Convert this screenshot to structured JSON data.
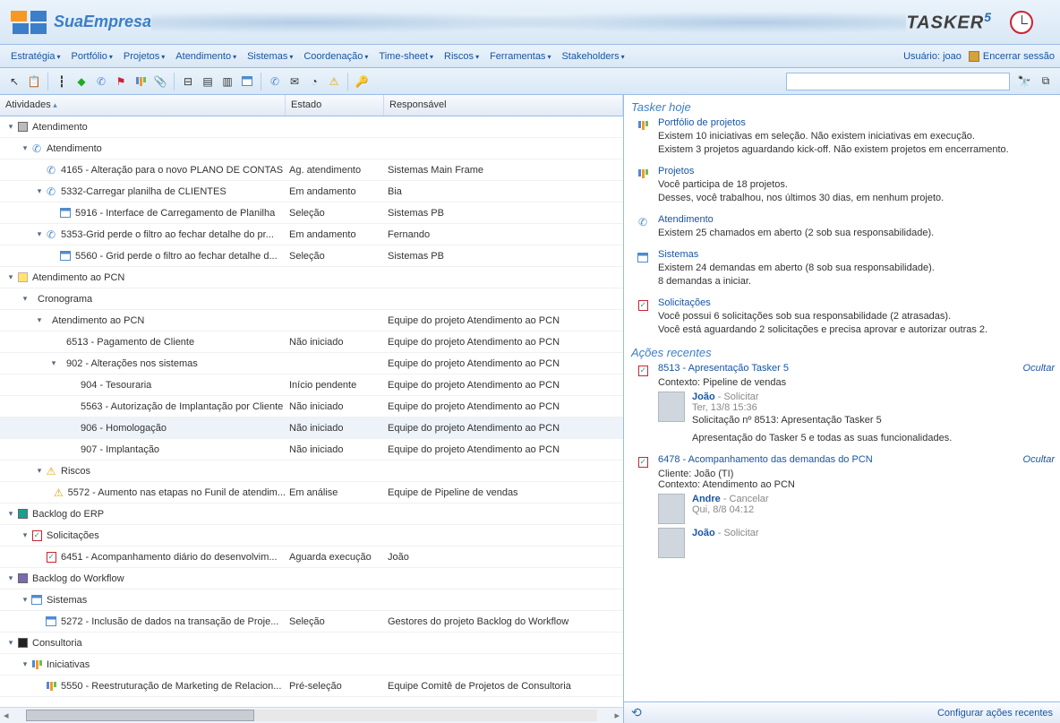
{
  "header": {
    "company": "SuaEmpresa",
    "brand": "TASKER",
    "brand_version": "5"
  },
  "menu": [
    "Estratégia",
    "Portfólio",
    "Projetos",
    "Atendimento",
    "Sistemas",
    "Coordenação",
    "Time-sheet",
    "Riscos",
    "Ferramentas",
    "Stakeholders"
  ],
  "user": {
    "label": "Usuário: joao",
    "logout": "Encerrar sessão"
  },
  "search_placeholder": "",
  "grid": {
    "columns": {
      "activities": "Atividades",
      "state": "Estado",
      "responsible": "Responsável"
    },
    "rows": [
      {
        "depth": 0,
        "exp": "▾",
        "icon": "sq-grey",
        "label": "Atendimento"
      },
      {
        "depth": 1,
        "exp": "▾",
        "icon": "phone",
        "label": "Atendimento"
      },
      {
        "depth": 2,
        "exp": "",
        "icon": "phone",
        "label": "4165 - Alteração para o novo PLANO DE CONTAS",
        "state": "Ag. atendimento",
        "resp": "Sistemas Main Frame"
      },
      {
        "depth": 2,
        "exp": "▾",
        "icon": "phone",
        "label": "5332-Carregar planilha de CLIENTES",
        "state": "Em andamento",
        "resp": "Bia"
      },
      {
        "depth": 3,
        "exp": "",
        "icon": "cal",
        "label": "5916 - Interface de Carregamento de Planilha",
        "state": "Seleção",
        "resp": "Sistemas PB"
      },
      {
        "depth": 2,
        "exp": "▾",
        "icon": "phone",
        "label": "5353-Grid perde o filtro ao fechar detalhe do pr...",
        "state": "Em andamento",
        "resp": "Fernando"
      },
      {
        "depth": 3,
        "exp": "",
        "icon": "cal",
        "label": "5560 - Grid perde o filtro ao fechar detalhe d...",
        "state": "Seleção",
        "resp": "Sistemas PB"
      },
      {
        "depth": 0,
        "exp": "▾",
        "icon": "sq-yellow",
        "label": "Atendimento ao PCN"
      },
      {
        "depth": 1,
        "exp": "▾",
        "icon": "",
        "label": "Cronograma"
      },
      {
        "depth": 2,
        "exp": "▾",
        "icon": "",
        "label": "Atendimento ao PCN",
        "resp": "Equipe do projeto Atendimento ao PCN"
      },
      {
        "depth": 3,
        "exp": "",
        "icon": "",
        "label": "6513 - Pagamento de Cliente",
        "state": "Não iniciado",
        "resp": "Equipe do projeto Atendimento ao PCN"
      },
      {
        "depth": 3,
        "exp": "▾",
        "icon": "",
        "label": "902 - Alterações nos sistemas",
        "resp": "Equipe do projeto Atendimento ao PCN"
      },
      {
        "depth": 4,
        "exp": "",
        "icon": "",
        "label": "904 - Tesouraria",
        "state": "Início pendente",
        "resp": "Equipe do projeto Atendimento ao PCN"
      },
      {
        "depth": 4,
        "exp": "",
        "icon": "",
        "label": "5563 - Autorização de Implantação por Cliente",
        "state": "Não iniciado",
        "resp": "Equipe do projeto Atendimento ao PCN"
      },
      {
        "depth": 4,
        "exp": "",
        "icon": "",
        "label": "906 - Homologação",
        "state": "Não iniciado",
        "resp": "Equipe do projeto Atendimento ao PCN",
        "hover": true
      },
      {
        "depth": 4,
        "exp": "",
        "icon": "",
        "label": "907 - Implantação",
        "state": "Não iniciado",
        "resp": "Equipe do projeto Atendimento ao PCN"
      },
      {
        "depth": 2,
        "exp": "▾",
        "icon": "warn",
        "label": "Riscos"
      },
      {
        "depth": 3,
        "exp": "",
        "icon": "warn",
        "label": "5572 - Aumento nas etapas no Funil de atendim...",
        "state": "Em análise",
        "resp": "Equipe de Pipeline de vendas"
      },
      {
        "depth": 0,
        "exp": "▾",
        "icon": "sq-teal",
        "label": "Backlog do ERP"
      },
      {
        "depth": 1,
        "exp": "▾",
        "icon": "check",
        "label": "Solicitações"
      },
      {
        "depth": 2,
        "exp": "",
        "icon": "check",
        "label": "6451 - Acompanhamento diário do desenvolvim...",
        "state": "Aguarda execução",
        "resp": "João"
      },
      {
        "depth": 0,
        "exp": "▾",
        "icon": "sq-purple",
        "label": "Backlog do Workflow"
      },
      {
        "depth": 1,
        "exp": "▾",
        "icon": "cal",
        "label": "Sistemas"
      },
      {
        "depth": 2,
        "exp": "",
        "icon": "cal",
        "label": "5272 - Inclusão de dados na transação de Proje...",
        "state": "Seleção",
        "resp": "Gestores do projeto Backlog do Workflow"
      },
      {
        "depth": 0,
        "exp": "▾",
        "icon": "sq-black",
        "label": "Consultoria"
      },
      {
        "depth": 1,
        "exp": "▾",
        "icon": "bars",
        "label": "Iniciativas"
      },
      {
        "depth": 2,
        "exp": "",
        "icon": "bars",
        "label": "5550 - Reestruturação de Marketing de Relacion...",
        "state": "Pré-seleção",
        "resp": "Equipe Comitê de Projetos de Consultoria"
      }
    ]
  },
  "today": {
    "title": "Tasker hoje",
    "blocks": [
      {
        "icon": "bars",
        "heading": "Portfólio de projetos",
        "lines": [
          "Existem 10 iniciativas em seleção. Não existem iniciativas em execução.",
          "Existem 3 projetos aguardando kick-off. Não existem projetos em encerramento."
        ]
      },
      {
        "icon": "proj",
        "heading": "Projetos",
        "lines": [
          "Você participa de 18 projetos.",
          "Desses, você trabalhou, nos últimos 30 dias, em nenhum projeto."
        ]
      },
      {
        "icon": "phone",
        "heading": "Atendimento",
        "lines": [
          "Existem 25 chamados em aberto (2 sob sua responsabilidade)."
        ]
      },
      {
        "icon": "cal",
        "heading": "Sistemas",
        "lines": [
          "Existem 24 demandas em aberto (8 sob sua responsabilidade).",
          "8 demandas a iniciar."
        ]
      },
      {
        "icon": "check",
        "heading": "Solicitações",
        "lines": [
          "Você possui 6 solicitações sob sua responsabilidade (2 atrasadas).",
          "Você está aguardando 2 solicitações e precisa aprovar e autorizar outras 2."
        ]
      }
    ]
  },
  "recent": {
    "title": "Ações recentes",
    "ocultar": "Ocultar",
    "cards": [
      {
        "title": "8513 - Apresentação Tasker 5",
        "meta": [
          "Contexto: Pipeline de vendas"
        ],
        "entries": [
          {
            "name": "João",
            "action": "Solicitar",
            "time": "Ter, 13/8 15:36",
            "body": [
              "Solicitação nº 8513: Apresentação Tasker 5",
              "",
              "Apresentação do Tasker 5 e todas as suas funcionalidades."
            ]
          }
        ]
      },
      {
        "title": "6478 - Acompanhamento das demandas do PCN",
        "meta": [
          "Cliente: João (TI)",
          "Contexto: Atendimento ao PCN"
        ],
        "entries": [
          {
            "name": "Andre",
            "action": "Cancelar",
            "time": "Qui, 8/8 04:12",
            "body": []
          },
          {
            "name": "João",
            "action": "Solicitar",
            "time": "",
            "body": []
          }
        ]
      }
    ]
  },
  "footer": {
    "config": "Configurar ações recentes"
  }
}
